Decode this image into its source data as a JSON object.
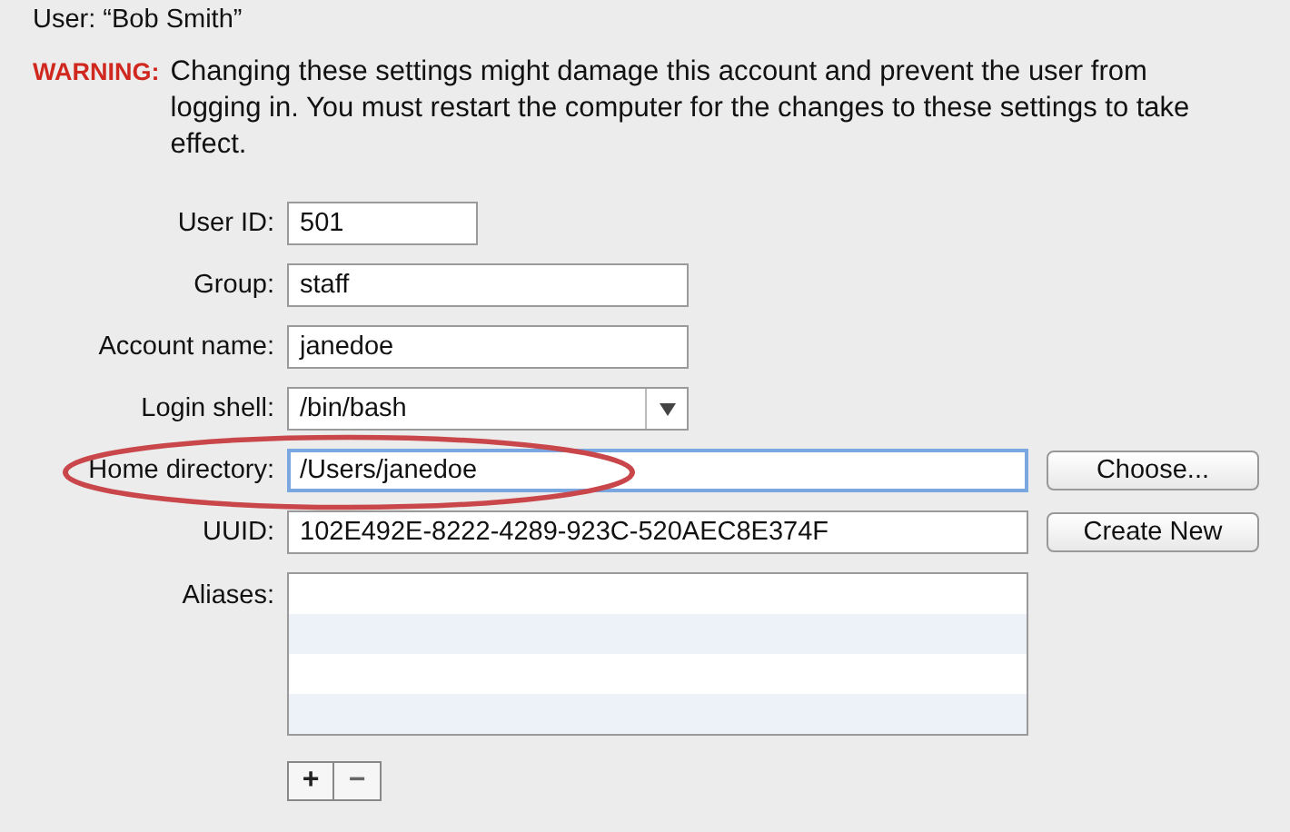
{
  "user_line": "User: “Bob Smith”",
  "warning": {
    "label": "WARNING:",
    "text": "Changing these settings might damage this account and prevent the user from logging in. You must restart the computer for the changes to these settings to take effect."
  },
  "fields": [
    {
      "kind": "text",
      "label": "User ID:",
      "value": "501"
    },
    {
      "kind": "text",
      "label": "Group:",
      "value": "staff"
    },
    {
      "kind": "text",
      "label": "Account name:",
      "value": "janedoe"
    },
    {
      "kind": "popup",
      "label": "Login shell:",
      "value": "/bin/bash"
    },
    {
      "kind": "text",
      "label": "Home directory:",
      "value": "/Users/janedoe",
      "focused": true,
      "circled": true,
      "button": "Choose..."
    },
    {
      "kind": "text",
      "label": "UUID:",
      "value": "102E492E-8222-4289-923C-520AEC8E374F",
      "button": "Create New"
    },
    {
      "kind": "list",
      "label": "Aliases:"
    }
  ],
  "list_buttons": [
    "+",
    "−"
  ]
}
